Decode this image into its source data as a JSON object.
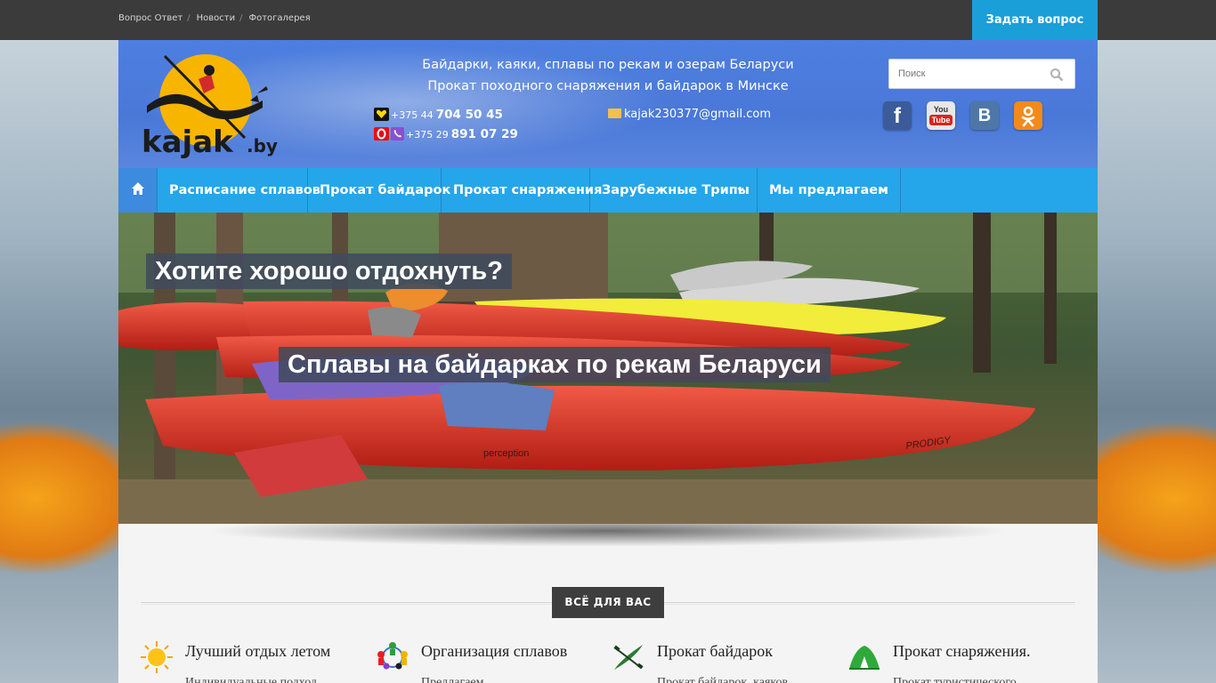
{
  "topbar": {
    "links": [
      "Вопрос Ответ",
      "Новости",
      "Фотогалерея"
    ],
    "ask_button": "Задать вопрос"
  },
  "header": {
    "logo_text": "kajak",
    "logo_suffix": ".by",
    "tagline_line1": "Байдарки, каяки, сплавы по рекам и озерам Беларуси",
    "tagline_line2": "Прокат походного снаряжения и байдарок в Минске",
    "phone1_prefix": "+375 44",
    "phone1_number": "704 50 45",
    "phone2_prefix": "+375 29",
    "phone2_number": "891 07 29",
    "email": "kajak230377@gmail.com",
    "search_placeholder": "Поиск",
    "socials": [
      "facebook-icon",
      "youtube-icon",
      "vkontakte-icon",
      "odnoklassniki-icon"
    ],
    "youtube_you": "You",
    "youtube_tube": "Tube"
  },
  "nav": {
    "home_icon": "home-icon",
    "items": [
      "Расписание сплавов",
      "Прокат байдарок",
      "Прокат снаряжения",
      "Зарубежные Трипы",
      "Мы предлагаем"
    ]
  },
  "slider": {
    "caption1": "Хотите хорошо отдохнуть?",
    "caption2": "Сплавы на байдарках по рекам Беларуси",
    "kayak_brand1": "perception",
    "kayak_brand2": "PRODIGY"
  },
  "section": {
    "title": "ВСЁ ДЛЯ ВАС"
  },
  "features": [
    {
      "icon": "sun-icon",
      "title": "Лучший отдых летом",
      "desc": "Индивидуальные подход"
    },
    {
      "icon": "people-icon",
      "title": "Организация сплавов",
      "desc": "Предлагаем"
    },
    {
      "icon": "kayak-icon",
      "title": "Прокат байдарок",
      "desc": "Прокат байдарок, каяков"
    },
    {
      "icon": "tent-icon",
      "title": "Прокат снаряжения.",
      "desc": "Прокат туристического"
    }
  ],
  "colors": {
    "topbar": "#3b3b3b",
    "accent": "#1a9fd9",
    "header_blue": "#4a78d8",
    "nav_blue": "#25a6ea",
    "section_title_bg": "#3e3e3e"
  }
}
